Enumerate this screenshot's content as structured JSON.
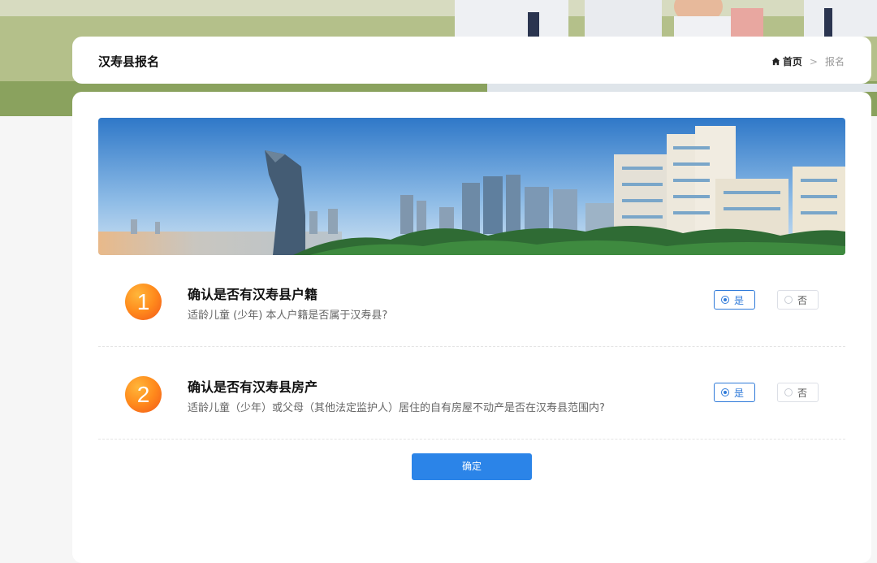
{
  "header": {
    "title": "汉寿县报名",
    "breadcrumb": {
      "home": "首页",
      "separator": ">",
      "current": "报名"
    }
  },
  "questions": [
    {
      "number": "1",
      "title": "确认是否有汉寿县户籍",
      "description": "适龄儿童 (少年) 本人户籍是否属于汉寿县?",
      "options": [
        {
          "label": "是",
          "selected": true
        },
        {
          "label": "否",
          "selected": false
        }
      ]
    },
    {
      "number": "2",
      "title": "确认是否有汉寿县房产",
      "description": "适龄儿童（少年）或父母（其他法定监护人）居住的自有房屋不动产是否在汉寿县范围内?",
      "options": [
        {
          "label": "是",
          "selected": true
        },
        {
          "label": "否",
          "selected": false
        }
      ]
    }
  ],
  "actions": {
    "confirm_label": "确定"
  },
  "colors": {
    "primary": "#2b84e8",
    "badge": "#ff8a1c",
    "background": "#f6f6f6"
  }
}
